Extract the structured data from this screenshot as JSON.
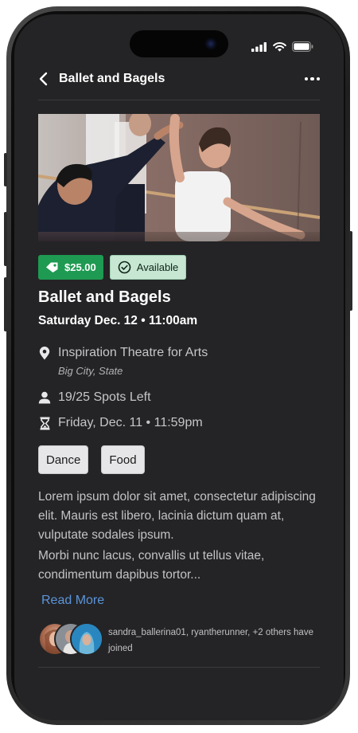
{
  "header": {
    "title": "Ballet and Bagels"
  },
  "event": {
    "price": "$25.00",
    "availability": "Available",
    "title": "Ballet and Bagels",
    "datetime": "Saturday Dec. 12 • 11:00am",
    "venue": "Inspiration Theatre for Arts",
    "location": "Big City, State",
    "spots": "19/25 Spots Left",
    "deadline": "Friday, Dec. 11 • 11:59pm"
  },
  "tags": [
    "Dance",
    "Food"
  ],
  "description": {
    "paragraph1": "Lorem ipsum dolor sit amet, consectetur adipiscing elit. Mauris est libero, lacinia dictum quam at, vulputate sodales ipsum.",
    "paragraph2": "Morbi nunc lacus, convallis ut tellus vitae, condimentum dapibus tortor...",
    "read_more": "Read More"
  },
  "attendees": {
    "joined_text": "sandra_ballerina01, ryantherunner, +2 others have joined"
  },
  "colors": {
    "price_badge": "#1e9a52",
    "available_badge": "#c7e7d2",
    "link": "#5b94d9",
    "screen_bg": "#242426"
  },
  "icons": {
    "back": "chevron-left-icon",
    "more": "more-horizontal-icon",
    "price": "price-tag-icon",
    "available": "check-circle-icon",
    "venue": "map-pin-icon",
    "spots": "person-icon",
    "deadline": "hourglass-icon"
  }
}
